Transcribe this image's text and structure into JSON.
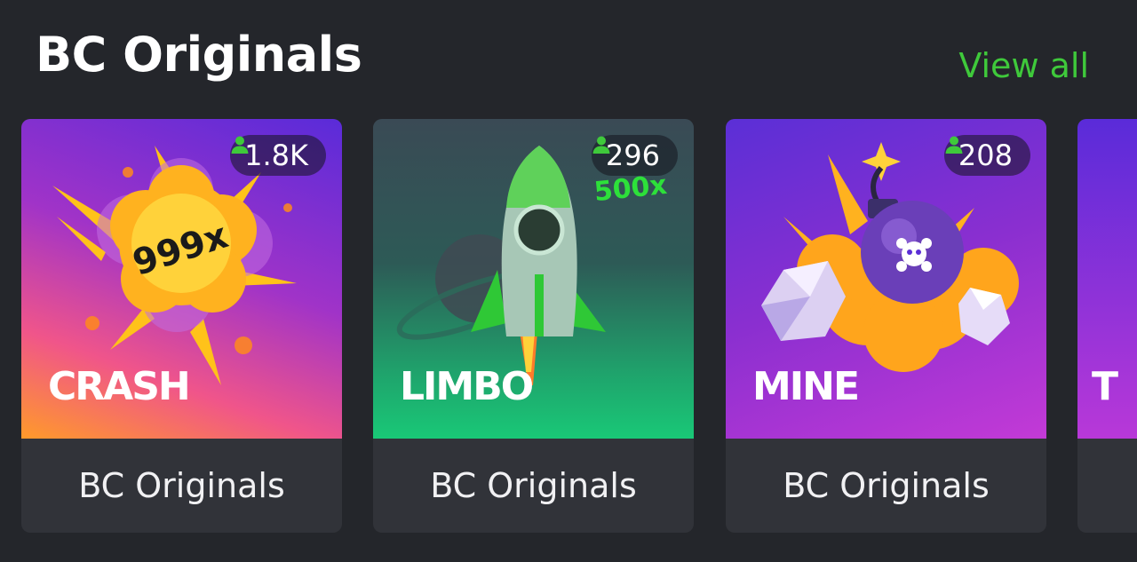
{
  "section": {
    "title": "BC Originals",
    "view_all_label": "View all"
  },
  "games": [
    {
      "name": "CRASH",
      "players": "1.8K",
      "provider": "BC Originals",
      "badge_text": "999x"
    },
    {
      "name": "LIMBO",
      "players": "296",
      "provider": "BC Originals",
      "badge_text": "500x"
    },
    {
      "name": "MINE",
      "players": "208",
      "provider": "BC Originals"
    },
    {
      "name": "T"
    }
  ],
  "colors": {
    "background": "#24262b",
    "card": "#313339",
    "accent_green": "#3fc93b"
  },
  "icons": {
    "players": "user-icon"
  }
}
